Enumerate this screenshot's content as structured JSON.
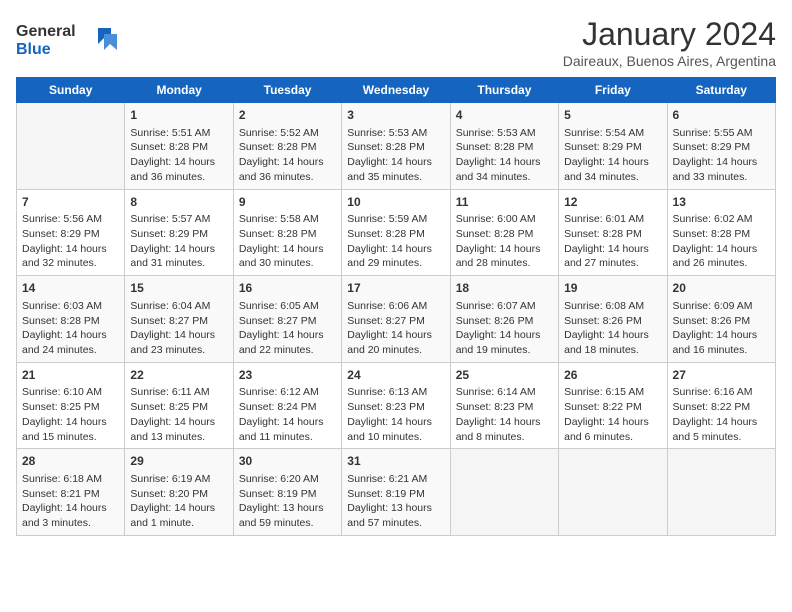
{
  "logo": {
    "line1": "General",
    "line2": "Blue"
  },
  "title": "January 2024",
  "location": "Daireaux, Buenos Aires, Argentina",
  "weekdays": [
    "Sunday",
    "Monday",
    "Tuesday",
    "Wednesday",
    "Thursday",
    "Friday",
    "Saturday"
  ],
  "weeks": [
    [
      {
        "day": "",
        "info": ""
      },
      {
        "day": "1",
        "info": "Sunrise: 5:51 AM\nSunset: 8:28 PM\nDaylight: 14 hours\nand 36 minutes."
      },
      {
        "day": "2",
        "info": "Sunrise: 5:52 AM\nSunset: 8:28 PM\nDaylight: 14 hours\nand 36 minutes."
      },
      {
        "day": "3",
        "info": "Sunrise: 5:53 AM\nSunset: 8:28 PM\nDaylight: 14 hours\nand 35 minutes."
      },
      {
        "day": "4",
        "info": "Sunrise: 5:53 AM\nSunset: 8:28 PM\nDaylight: 14 hours\nand 34 minutes."
      },
      {
        "day": "5",
        "info": "Sunrise: 5:54 AM\nSunset: 8:29 PM\nDaylight: 14 hours\nand 34 minutes."
      },
      {
        "day": "6",
        "info": "Sunrise: 5:55 AM\nSunset: 8:29 PM\nDaylight: 14 hours\nand 33 minutes."
      }
    ],
    [
      {
        "day": "7",
        "info": "Sunrise: 5:56 AM\nSunset: 8:29 PM\nDaylight: 14 hours\nand 32 minutes."
      },
      {
        "day": "8",
        "info": "Sunrise: 5:57 AM\nSunset: 8:29 PM\nDaylight: 14 hours\nand 31 minutes."
      },
      {
        "day": "9",
        "info": "Sunrise: 5:58 AM\nSunset: 8:28 PM\nDaylight: 14 hours\nand 30 minutes."
      },
      {
        "day": "10",
        "info": "Sunrise: 5:59 AM\nSunset: 8:28 PM\nDaylight: 14 hours\nand 29 minutes."
      },
      {
        "day": "11",
        "info": "Sunrise: 6:00 AM\nSunset: 8:28 PM\nDaylight: 14 hours\nand 28 minutes."
      },
      {
        "day": "12",
        "info": "Sunrise: 6:01 AM\nSunset: 8:28 PM\nDaylight: 14 hours\nand 27 minutes."
      },
      {
        "day": "13",
        "info": "Sunrise: 6:02 AM\nSunset: 8:28 PM\nDaylight: 14 hours\nand 26 minutes."
      }
    ],
    [
      {
        "day": "14",
        "info": "Sunrise: 6:03 AM\nSunset: 8:28 PM\nDaylight: 14 hours\nand 24 minutes."
      },
      {
        "day": "15",
        "info": "Sunrise: 6:04 AM\nSunset: 8:27 PM\nDaylight: 14 hours\nand 23 minutes."
      },
      {
        "day": "16",
        "info": "Sunrise: 6:05 AM\nSunset: 8:27 PM\nDaylight: 14 hours\nand 22 minutes."
      },
      {
        "day": "17",
        "info": "Sunrise: 6:06 AM\nSunset: 8:27 PM\nDaylight: 14 hours\nand 20 minutes."
      },
      {
        "day": "18",
        "info": "Sunrise: 6:07 AM\nSunset: 8:26 PM\nDaylight: 14 hours\nand 19 minutes."
      },
      {
        "day": "19",
        "info": "Sunrise: 6:08 AM\nSunset: 8:26 PM\nDaylight: 14 hours\nand 18 minutes."
      },
      {
        "day": "20",
        "info": "Sunrise: 6:09 AM\nSunset: 8:26 PM\nDaylight: 14 hours\nand 16 minutes."
      }
    ],
    [
      {
        "day": "21",
        "info": "Sunrise: 6:10 AM\nSunset: 8:25 PM\nDaylight: 14 hours\nand 15 minutes."
      },
      {
        "day": "22",
        "info": "Sunrise: 6:11 AM\nSunset: 8:25 PM\nDaylight: 14 hours\nand 13 minutes."
      },
      {
        "day": "23",
        "info": "Sunrise: 6:12 AM\nSunset: 8:24 PM\nDaylight: 14 hours\nand 11 minutes."
      },
      {
        "day": "24",
        "info": "Sunrise: 6:13 AM\nSunset: 8:23 PM\nDaylight: 14 hours\nand 10 minutes."
      },
      {
        "day": "25",
        "info": "Sunrise: 6:14 AM\nSunset: 8:23 PM\nDaylight: 14 hours\nand 8 minutes."
      },
      {
        "day": "26",
        "info": "Sunrise: 6:15 AM\nSunset: 8:22 PM\nDaylight: 14 hours\nand 6 minutes."
      },
      {
        "day": "27",
        "info": "Sunrise: 6:16 AM\nSunset: 8:22 PM\nDaylight: 14 hours\nand 5 minutes."
      }
    ],
    [
      {
        "day": "28",
        "info": "Sunrise: 6:18 AM\nSunset: 8:21 PM\nDaylight: 14 hours\nand 3 minutes."
      },
      {
        "day": "29",
        "info": "Sunrise: 6:19 AM\nSunset: 8:20 PM\nDaylight: 14 hours\nand 1 minute."
      },
      {
        "day": "30",
        "info": "Sunrise: 6:20 AM\nSunset: 8:19 PM\nDaylight: 13 hours\nand 59 minutes."
      },
      {
        "day": "31",
        "info": "Sunrise: 6:21 AM\nSunset: 8:19 PM\nDaylight: 13 hours\nand 57 minutes."
      },
      {
        "day": "",
        "info": ""
      },
      {
        "day": "",
        "info": ""
      },
      {
        "day": "",
        "info": ""
      }
    ]
  ]
}
